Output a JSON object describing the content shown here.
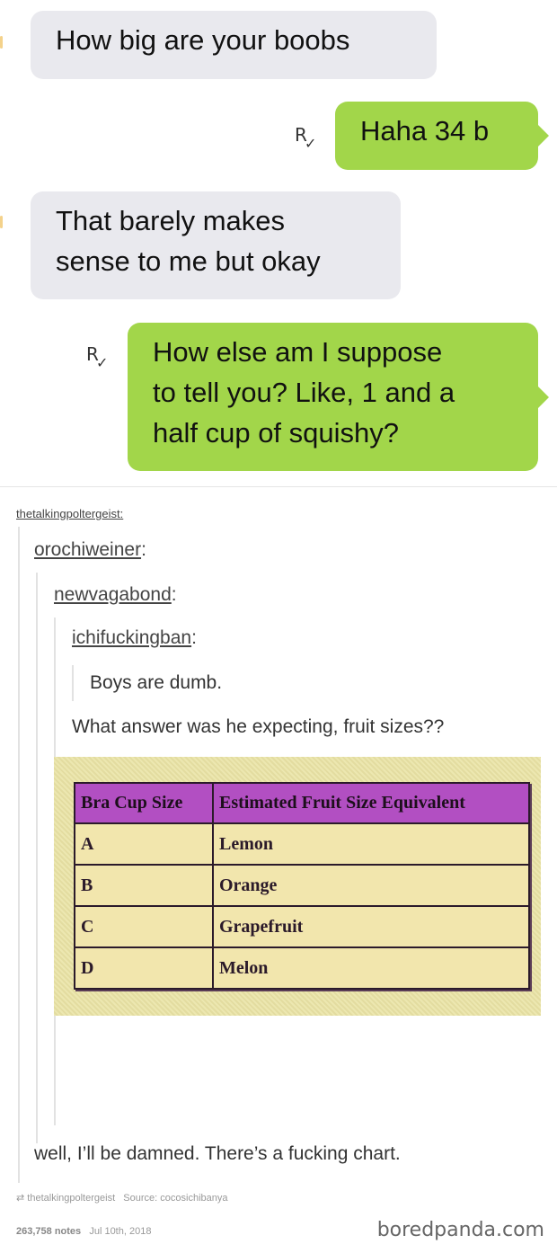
{
  "messages": [
    {
      "direction": "incoming",
      "text": "How big are your boobs"
    },
    {
      "direction": "outgoing",
      "text": "Haha 34 b",
      "read_icon": "read-receipt-icon"
    },
    {
      "direction": "incoming",
      "lines": [
        "That barely makes",
        "sense to me but okay"
      ]
    },
    {
      "direction": "outgoing",
      "lines": [
        "How else am I suppose",
        "to tell you? Like, 1 and a",
        "half cup of squishy?"
      ],
      "read_icon": "read-receipt-icon"
    }
  ],
  "read_receipt_glyph": "R",
  "read_receipt_check": "✓",
  "post": {
    "top_blog": "thetalkingpoltergeist:",
    "reblogs": [
      {
        "user": "orochiweiner",
        "suffix": ":"
      },
      {
        "user": "newvagabond",
        "suffix": ":"
      },
      {
        "user": "ichifuckingban",
        "suffix": ":"
      }
    ],
    "quote_text": "Boys are dumb.",
    "reply_text": "What answer was he expecting, fruit sizes??",
    "chart": {
      "headers": [
        "Bra Cup Size",
        "Estimated Fruit Size Equivalent"
      ],
      "rows": [
        [
          "A",
          "Lemon"
        ],
        [
          "B",
          "Orange"
        ],
        [
          "C",
          "Grapefruit"
        ],
        [
          "D",
          "Melon"
        ]
      ]
    },
    "final_text": "well, I’ll be damned. There’s a fucking chart.",
    "footer": {
      "reblog_icon": "reblog-icon",
      "reblog_user": "thetalkingpoltergeist",
      "source_label": "Source:",
      "source_user": "cocosichibanya",
      "notes": "263,758 notes",
      "date": "Jul 10th, 2018"
    }
  },
  "watermark": "boredpanda.com"
}
